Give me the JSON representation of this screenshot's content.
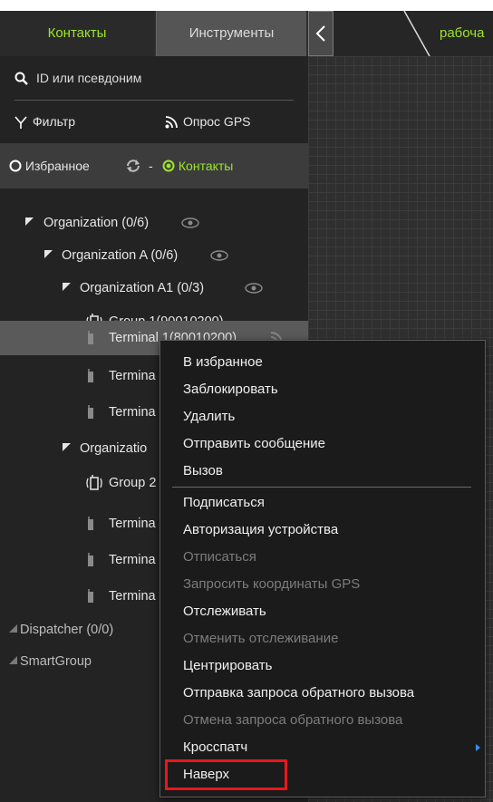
{
  "tabs": {
    "contacts": "Контакты",
    "tools": "Инструменты"
  },
  "workspace": {
    "title": "рабоча"
  },
  "search": {
    "placeholder": "ID или псевдоним"
  },
  "toolbar": {
    "filter": "Фильтр",
    "gps": "Опрос GPS"
  },
  "favorites": {
    "favorites_label": "Избранное",
    "dash": "-",
    "contacts_label": "Контакты"
  },
  "tree": {
    "org": "Organization (0/6)",
    "org_a": "Organization A (0/6)",
    "org_a1": "Organization A1 (0/3)",
    "group1": "Group 1(90010200)",
    "terminal1": "Terminal 1(80010200)",
    "terminal_a": "Termina",
    "terminal_b": "Termina",
    "org_partial": "Organizatio",
    "group_partial": "Group 2",
    "terminal_c": "Termina",
    "terminal_d": "Termina",
    "terminal_e": "Termina",
    "dispatcher": "Dispatcher (0/0)",
    "smartgroup": "SmartGroup"
  },
  "menu": {
    "items": [
      {
        "label": "В избранное",
        "enabled": true
      },
      {
        "label": "Заблокировать",
        "enabled": true
      },
      {
        "label": "Удалить",
        "enabled": true
      },
      {
        "label": "Отправить сообщение",
        "enabled": true
      },
      {
        "label": "Вызов",
        "enabled": true
      },
      {
        "label": "Подписаться",
        "enabled": true
      },
      {
        "label": "Авторизация устройства",
        "enabled": true
      },
      {
        "label": "Отписаться",
        "enabled": false
      },
      {
        "label": "Запросить координаты GPS",
        "enabled": false
      },
      {
        "label": "Отслеживать",
        "enabled": true
      },
      {
        "label": "Отменить отслеживание",
        "enabled": false
      },
      {
        "label": "Центрировать",
        "enabled": true
      },
      {
        "label": "Отправка запроса обратного вызова",
        "enabled": true
      },
      {
        "label": "Отмена запроса обратного вызова",
        "enabled": false
      },
      {
        "label": "Кросспатч",
        "enabled": true
      },
      {
        "label": "Наверх",
        "enabled": true
      }
    ]
  },
  "colors": {
    "accent": "#9be52b",
    "highlight": "#e8171c",
    "submenu_arrow": "#3a8ee6"
  }
}
